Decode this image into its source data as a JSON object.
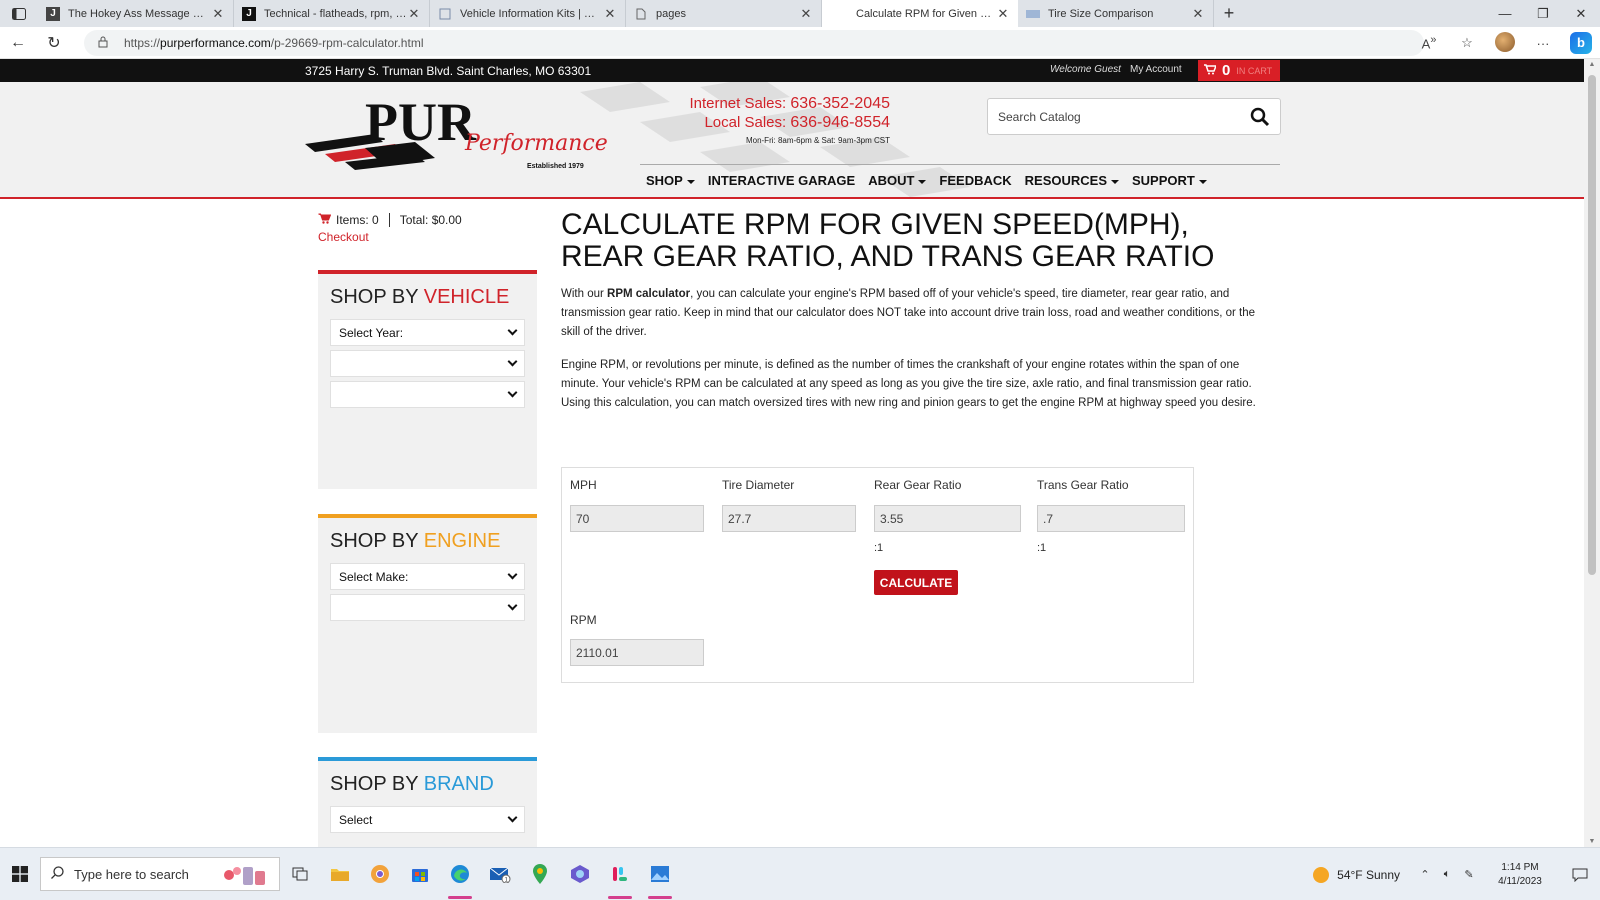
{
  "browser": {
    "tabs": [
      {
        "title": "The Hokey Ass Message Board |",
        "favicon": "J",
        "active": false
      },
      {
        "title": "Technical - flatheads, rpm, torque",
        "favicon": "J",
        "active": false
      },
      {
        "title": "Vehicle Information Kits | GM He",
        "favicon": "",
        "active": false
      },
      {
        "title": "pages",
        "favicon": "",
        "active": false
      },
      {
        "title": "Calculate RPM for Given Speed(M",
        "favicon": "",
        "active": true
      },
      {
        "title": "Tire Size Comparison",
        "favicon": "",
        "active": false
      }
    ],
    "url_prefix": "https://",
    "url_domain": "purperformance.com",
    "url_path": "/p-29669-rpm-calculator.html"
  },
  "site": {
    "address": "3725 Harry S. Truman Blvd. Saint Charles, MO 63301",
    "welcome": "Welcome Guest",
    "my_account": "My Account",
    "cart_count": "0",
    "cart_label": "IN CART",
    "logo_text": "PUR",
    "logo_script": "Performance",
    "logo_est": "Established 1979",
    "internet_sales_label": "Internet Sales:",
    "internet_sales_phone": "636-352-2045",
    "local_sales_label": "Local Sales:",
    "local_sales_phone": "636-946-8554",
    "hours": "Mon-Fri: 8am-6pm & Sat: 9am-3pm CST",
    "search_placeholder": "Search Catalog",
    "nav": [
      {
        "label": "SHOP",
        "dropdown": true
      },
      {
        "label": "INTERACTIVE GARAGE",
        "dropdown": false
      },
      {
        "label": "ABOUT",
        "dropdown": true
      },
      {
        "label": "FEEDBACK",
        "dropdown": false
      },
      {
        "label": "RESOURCES",
        "dropdown": true
      },
      {
        "label": "SUPPORT",
        "dropdown": true
      }
    ]
  },
  "sidebar": {
    "items_label": "Items: 0",
    "total_label": "Total: $0.00",
    "checkout": "Checkout",
    "vehicle": {
      "prefix": "SHOP BY ",
      "accent": "VEHICLE",
      "accent_color": "#d0232a",
      "selects": [
        "Select Year:",
        "",
        ""
      ]
    },
    "engine": {
      "prefix": "SHOP BY ",
      "accent": "ENGINE",
      "accent_color": "#f0a020",
      "selects": [
        "Select Make:",
        ""
      ]
    },
    "brand": {
      "prefix": "SHOP BY ",
      "accent": "BRAND",
      "accent_color": "#2a9ad8",
      "selects": [
        "Select"
      ]
    }
  },
  "main": {
    "title": "CALCULATE RPM FOR GIVEN SPEED(MPH), REAR GEAR RATIO, AND TRANS GEAR RATIO",
    "p1_before": "With our ",
    "p1_bold": "RPM calculator",
    "p1_after": ", you can calculate your engine's RPM based off of your vehicle's speed, tire diameter, rear gear ratio, and transmission gear ratio. Keep in mind that our calculator does NOT take into account drive train loss, road and weather conditions, or the skill of the driver.",
    "p2": "Engine RPM, or revolutions per minute, is defined as the number of times the crankshaft of your engine rotates within the span of one minute. Your vehicle's RPM can be calculated at any speed as long as you give the tire size, axle ratio, and final transmission gear ratio. Using this calculation, you can match oversized tires with new ring and pinion gears to get the engine RPM at highway speed you desire.",
    "calc": {
      "mph_label": "MPH",
      "mph_value": "70",
      "tire_label": "Tire Diameter",
      "tire_value": "27.7",
      "rear_label": "Rear Gear Ratio",
      "rear_value": "3.55",
      "rear_suffix": ":1",
      "trans_label": "Trans Gear Ratio",
      "trans_value": ".7",
      "trans_suffix": ":1",
      "button": "CALCULATE",
      "rpm_label": "RPM",
      "rpm_value": "2110.01"
    }
  },
  "taskbar": {
    "search_placeholder": "Type here to search",
    "weather": "54°F  Sunny",
    "time": "1:14 PM",
    "date": "4/11/2023"
  }
}
